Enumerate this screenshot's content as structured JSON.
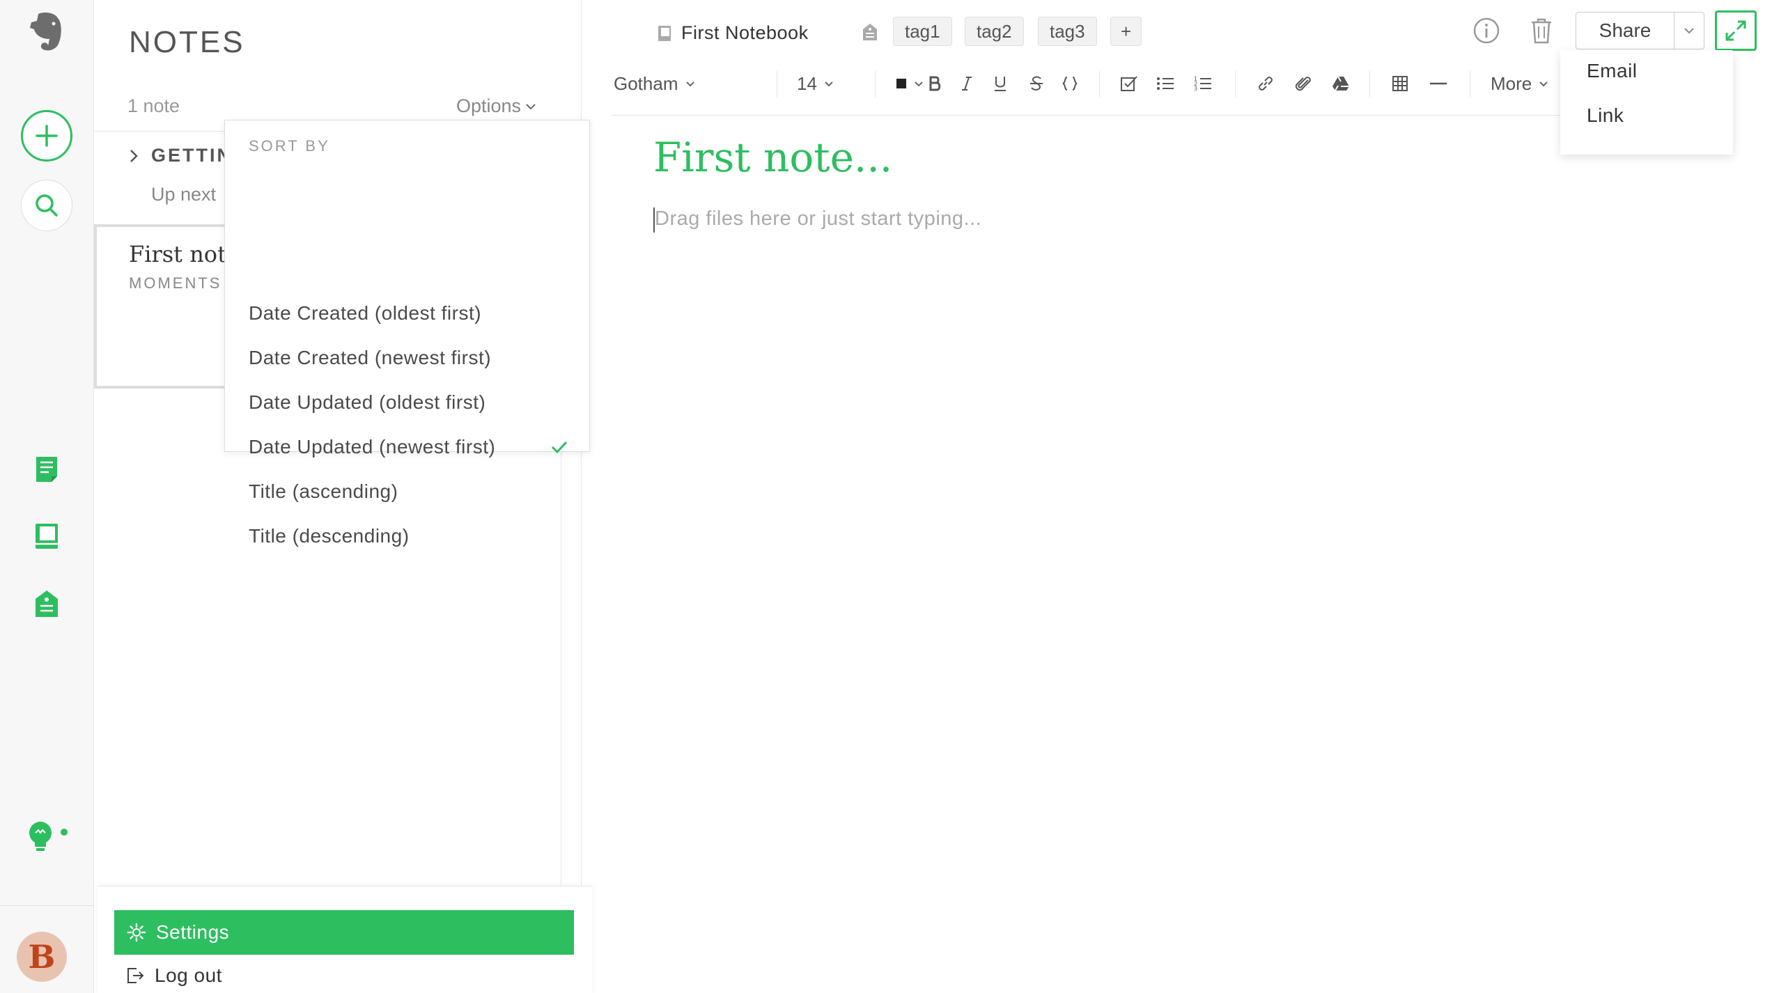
{
  "colors": {
    "accent": "#2dbe60",
    "rail_bg": "#f7f7f7",
    "text": "#333333",
    "muted": "#999999"
  },
  "rail": {
    "logo_icon": "elephant-logo-icon",
    "new_note_icon": "plus-icon",
    "search_icon": "search-icon",
    "nav_icons": [
      "notes-icon",
      "notebooks-icon",
      "tags-icon"
    ],
    "tip_icon": "lightbulb-icon",
    "avatar_letter": "B"
  },
  "notes_list": {
    "title": "NOTES",
    "count": "1 note",
    "options_label": "Options",
    "group_label": "GETTIN",
    "up_next": "Up next",
    "note": {
      "title": "First note",
      "meta": "MOMENTS"
    }
  },
  "sort_menu": {
    "header": "SORT BY",
    "items": [
      {
        "label": "Date Created (oldest first)",
        "selected": false
      },
      {
        "label": "Date Created (newest first)",
        "selected": false
      },
      {
        "label": "Date Updated (oldest first)",
        "selected": false
      },
      {
        "label": "Date Updated (newest first)",
        "selected": true
      },
      {
        "label": "Title (ascending)",
        "selected": false
      },
      {
        "label": "Title (descending)",
        "selected": false
      }
    ]
  },
  "account_menu": {
    "settings": "Settings",
    "logout": "Log out"
  },
  "editor": {
    "notebook": "First Notebook",
    "tags": [
      "tag1",
      "tag2",
      "tag3"
    ],
    "add_tag": "+",
    "share_label": "Share",
    "share_menu": [
      "Email",
      "Link"
    ],
    "toolbar": {
      "font": "Gotham",
      "size": "14",
      "more": "More"
    },
    "note_title": "First note...",
    "body_placeholder": "Drag files here or just start typing..."
  }
}
